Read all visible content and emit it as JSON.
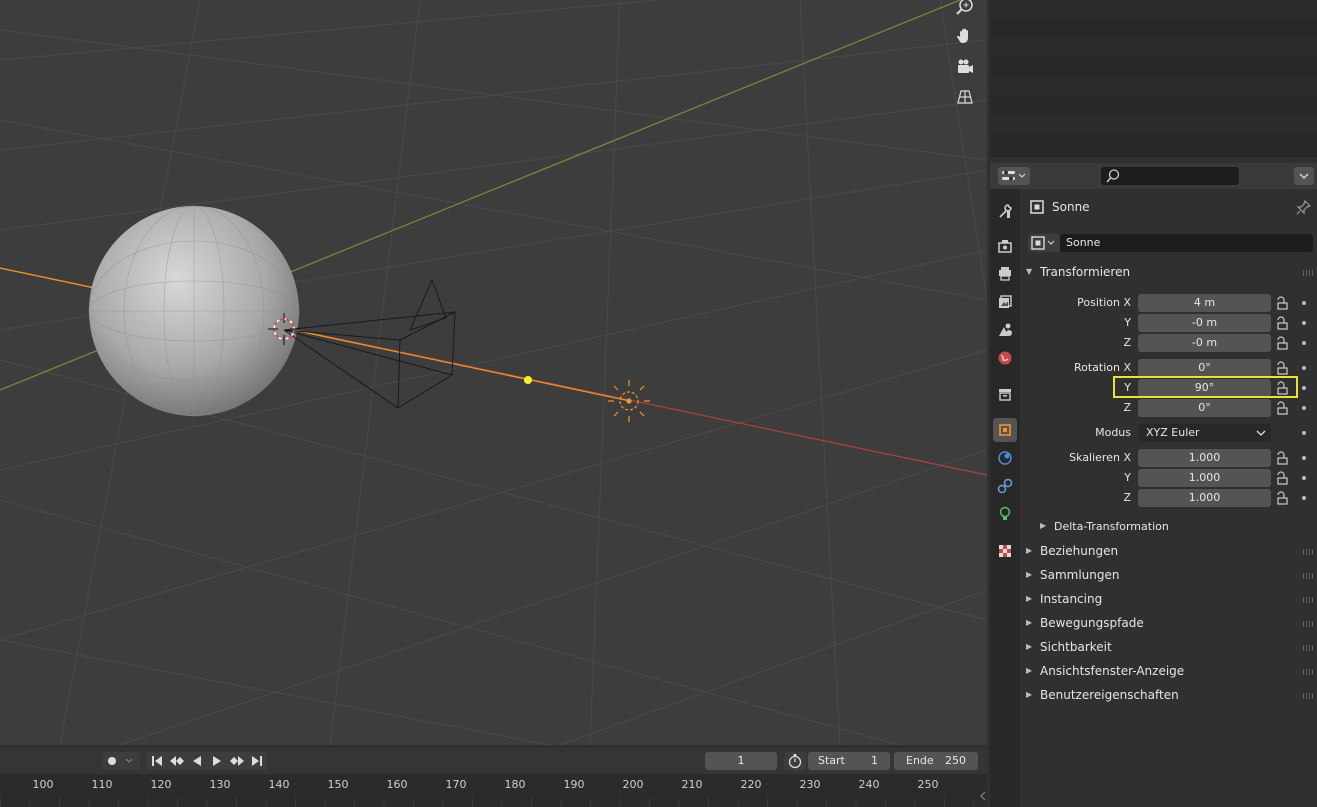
{
  "viewport": {
    "nav_icons": [
      "zoom-icon",
      "pan-hand-icon",
      "camera-view-icon",
      "ortho-grid-icon"
    ]
  },
  "props_header": {
    "editor_icon": "properties-editor-icon",
    "search_placeholder": ""
  },
  "tabs": [
    {
      "name": "tool-tab-icon",
      "active": false
    },
    {
      "name": "render-tab-icon",
      "active": false
    },
    {
      "name": "output-tab-icon",
      "active": false
    },
    {
      "name": "view-layer-tab-icon",
      "active": false
    },
    {
      "name": "scene-tab-icon",
      "active": false
    },
    {
      "name": "world-tab-icon",
      "active": false
    },
    {
      "name": "collection-tab-icon",
      "active": false
    },
    {
      "name": "object-tab-icon",
      "active": true
    },
    {
      "name": "physics-tab-icon",
      "active": false
    },
    {
      "name": "constraints-tab-icon",
      "active": false
    },
    {
      "name": "light-data-tab-icon",
      "active": false
    },
    {
      "name": "texture-tab-icon",
      "active": false
    }
  ],
  "object": {
    "title": "Sonne",
    "name_value": "Sonne"
  },
  "transform": {
    "header": "Transformieren",
    "position_label": "Position X",
    "y_label": "Y",
    "z_label": "Z",
    "position": [
      "4 m",
      "-0 m",
      "-0 m"
    ],
    "rotation_label": "Rotation X",
    "rotation": [
      "0°",
      "90°",
      "0°"
    ],
    "mode_label": "Modus",
    "mode_value": "XYZ Euler",
    "scale_label": "Skalieren X",
    "scale": [
      "1.000",
      "1.000",
      "1.000"
    ],
    "delta": "Delta-Transformation"
  },
  "panels": [
    "Beziehungen",
    "Sammlungen",
    "Instancing",
    "Bewegungspfade",
    "Sichtbarkeit",
    "Ansichtsfenster-Anzeige",
    "Benutzereigenschaften"
  ],
  "highlight_color": "#e8e23a",
  "timeline": {
    "current_frame": "1",
    "start_label": "Start",
    "start_value": "1",
    "end_label": "Ende",
    "end_value": "250",
    "ticks": [
      "100",
      "110",
      "120",
      "130",
      "140",
      "150",
      "160",
      "170",
      "180",
      "190",
      "200",
      "210",
      "220",
      "230",
      "240",
      "250"
    ]
  }
}
